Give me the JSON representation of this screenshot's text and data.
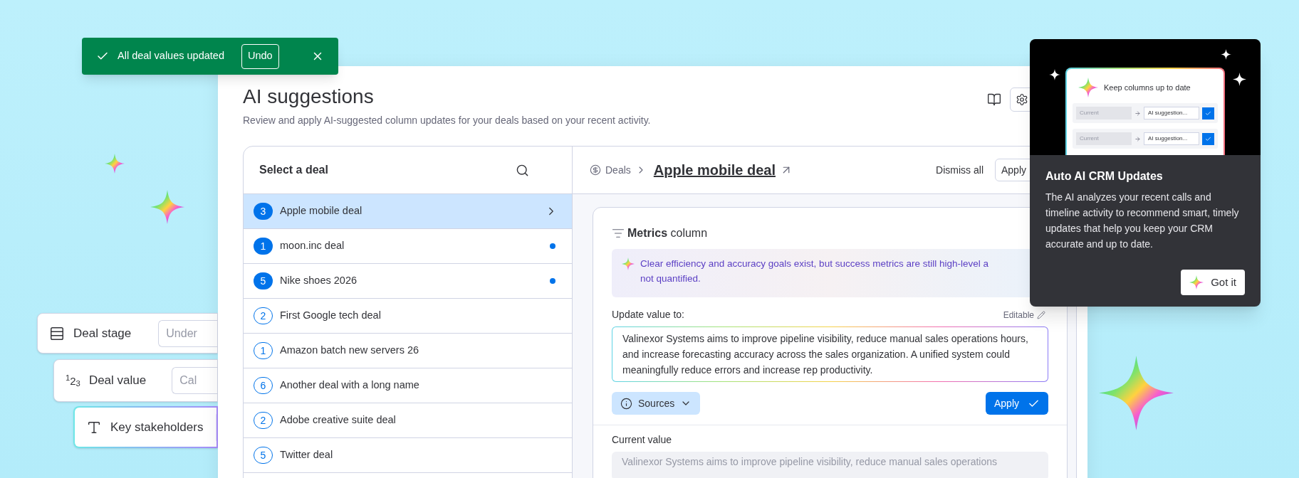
{
  "toast": {
    "message": "All deal values updated",
    "action": "Undo"
  },
  "floating_fields": [
    {
      "kind": "stage",
      "label": "Deal stage",
      "value": "Under",
      "selected": false
    },
    {
      "kind": "number",
      "icon_text": "$^{1}$2$_{3}$",
      "label": "Deal value",
      "value": "Cal",
      "selected": false
    },
    {
      "kind": "text",
      "label": "Key stakeholders",
      "selected": true
    }
  ],
  "page": {
    "title": "AI suggestions",
    "subtitle": "Review and apply AI-suggested column updates for your deals based on your recent activity."
  },
  "deal_list": {
    "title": "Select a deal",
    "items": [
      {
        "count": "3",
        "name": "Apple mobile deal",
        "badge_filled": true,
        "unread": false,
        "selected": true
      },
      {
        "count": "1",
        "name": "moon.inc deal",
        "badge_filled": true,
        "unread": true,
        "selected": false
      },
      {
        "count": "5",
        "name": "Nike shoes 2026",
        "badge_filled": true,
        "unread": true,
        "selected": false
      },
      {
        "count": "2",
        "name": "First Google tech deal",
        "badge_filled": false,
        "unread": false,
        "selected": false
      },
      {
        "count": "1",
        "name": "Amazon batch new servers 26",
        "badge_filled": false,
        "unread": false,
        "selected": false
      },
      {
        "count": "6",
        "name": "Another deal with a long name",
        "badge_filled": false,
        "unread": false,
        "selected": false
      },
      {
        "count": "2",
        "name": "Adobe creative suite deal",
        "badge_filled": false,
        "unread": false,
        "selected": false
      },
      {
        "count": "5",
        "name": "Twitter deal",
        "badge_filled": false,
        "unread": false,
        "selected": false
      }
    ]
  },
  "detail": {
    "breadcrumb": "Deals",
    "deal_name": "Apple mobile deal",
    "dismiss_all": "Dismiss all",
    "apply_all": "Apply",
    "column_name": "Metrics",
    "column_suffix": "column",
    "insight_lines": [
      "Clear efficiency and accuracy goals exist, but success metrics are still high-level a",
      "not quantified."
    ],
    "update_label": "Update value to:",
    "editable": "Editable",
    "new_value": "Valinexor Systems aims to improve pipeline visibility, reduce manual sales operations hours, and increase forecasting accuracy across the sales organization. A unified system could meaningfully reduce errors and increase rep productivity.",
    "sources": "Sources",
    "apply": "Apply",
    "current_label": "Current value",
    "current_value": "Valinexor Systems aims to improve pipeline visibility, reduce manual sales operations"
  },
  "popover": {
    "preview_title": "Keep columns up to date",
    "preview_rows": [
      {
        "current": "Current",
        "suggestion": "AI suggestion..."
      },
      {
        "current": "Current",
        "suggestion": "AI suggestion..."
      }
    ],
    "title": "Auto AI CRM Updates",
    "body": "The AI analyzes your recent calls and timeline activity to recommend smart, timely updates that help you keep your CRM accurate and up to date.",
    "button": "Got it"
  }
}
